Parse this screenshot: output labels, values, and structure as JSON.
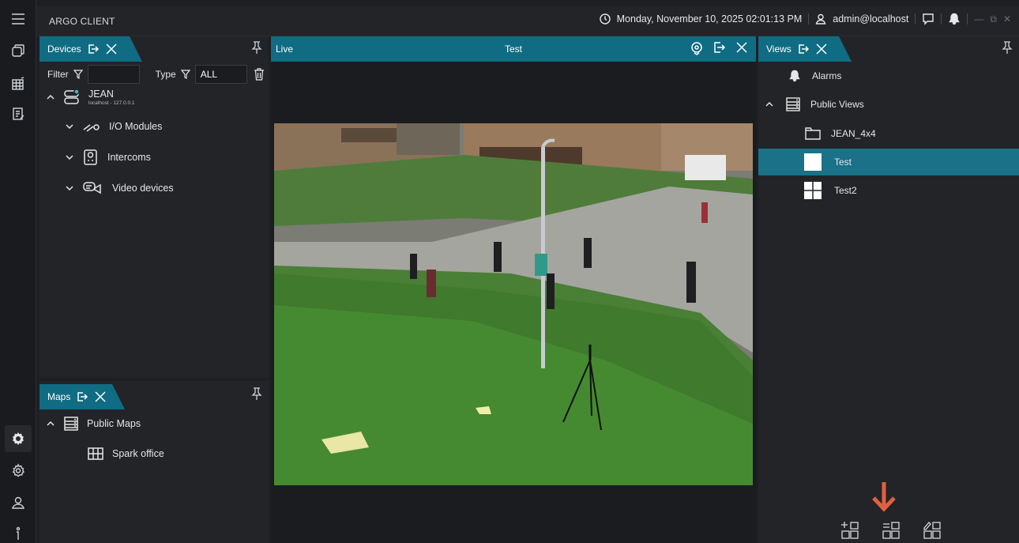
{
  "app": {
    "title": "ARGO CLIENT"
  },
  "topbar": {
    "datetime": "Monday, November 10, 2025 02:01:13 PM",
    "user": "admin@localhost"
  },
  "devices": {
    "tab_label": "Devices",
    "filter_label": "Filter",
    "filter_value": "",
    "type_label": "Type",
    "type_value": "ALL",
    "server": {
      "name": "JEAN",
      "address": "localhost - 127.0.0.1"
    },
    "groups": [
      {
        "label": "I/O Modules"
      },
      {
        "label": "Intercoms"
      },
      {
        "label": "Video devices"
      }
    ]
  },
  "maps": {
    "tab_label": "Maps",
    "folder": "Public Maps",
    "items": [
      {
        "label": "Spark office"
      }
    ]
  },
  "live": {
    "tab_label": "Live",
    "view_title": "Test"
  },
  "views": {
    "tab_label": "Views",
    "alarms": "Alarms",
    "folder": "Public Views",
    "items": [
      {
        "label": "JEAN_4x4",
        "selected": false
      },
      {
        "label": "Test",
        "selected": true
      },
      {
        "label": "Test2",
        "selected": false
      }
    ]
  },
  "colors": {
    "accent": "#0f6c83",
    "selected_row": "#1a7188",
    "arrow": "#e0603f"
  }
}
